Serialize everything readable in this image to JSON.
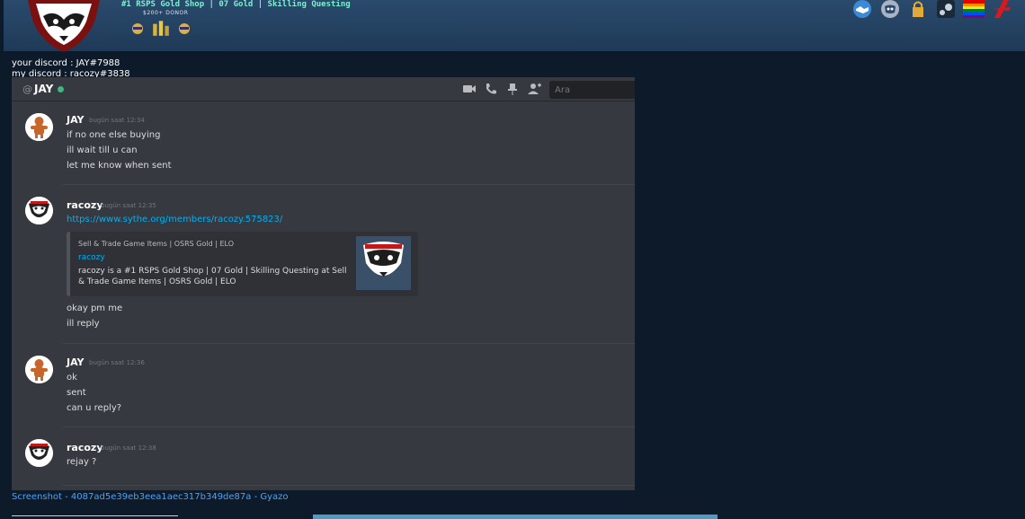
{
  "forum_header": {
    "tagline": "#1 RSPS Gold Shop | 07 Gold | Skilling Questing",
    "rank": "$200+ DONOR",
    "icons": [
      "handshake-icon",
      "discord-icon",
      "lock-icon",
      "steam-icon",
      "rainbow-flag-icon",
      "red-brand-icon"
    ]
  },
  "post": {
    "line1": "your discord : JAY#7988",
    "line2": "my discord : racozy#3838"
  },
  "discord": {
    "at": "@",
    "channel": "JAY",
    "search_placeholder": "Ara",
    "messages": [
      {
        "author": "JAY",
        "time": "bugün saat 12:34",
        "lines": [
          "if no one else buying",
          "ill wait till u can",
          "let me know when sent"
        ]
      },
      {
        "author": "racozy",
        "time": "bugün saat 12:35",
        "lines": [
          "https://www.sythe.org/members/racozy.575823/"
        ],
        "embed": {
          "provider": "Sell & Trade Game Items | OSRS Gold | ELO",
          "title": "racozy",
          "desc": "racozy is a #1 RSPS Gold Shop | 07 Gold | Skilling Questing at Sell & Trade Game Items | OSRS Gold | ELO"
        },
        "after": [
          "okay pm me",
          "ill reply"
        ]
      },
      {
        "author": "JAY",
        "time": "bugün saat 12:36",
        "lines": [
          "ok",
          "sent",
          "can u reply?"
        ]
      },
      {
        "author": "racozy",
        "time": "bugün saat 12:38",
        "lines": [
          "rejay ?"
        ]
      }
    ]
  },
  "caption": "Screenshot - 4087ad5e39eb3eea1aec317b349de87a - Gyazo",
  "colors": {
    "accent_link": "#00b0f4",
    "online": "#43b581",
    "page_bg": "#0d1a29"
  }
}
